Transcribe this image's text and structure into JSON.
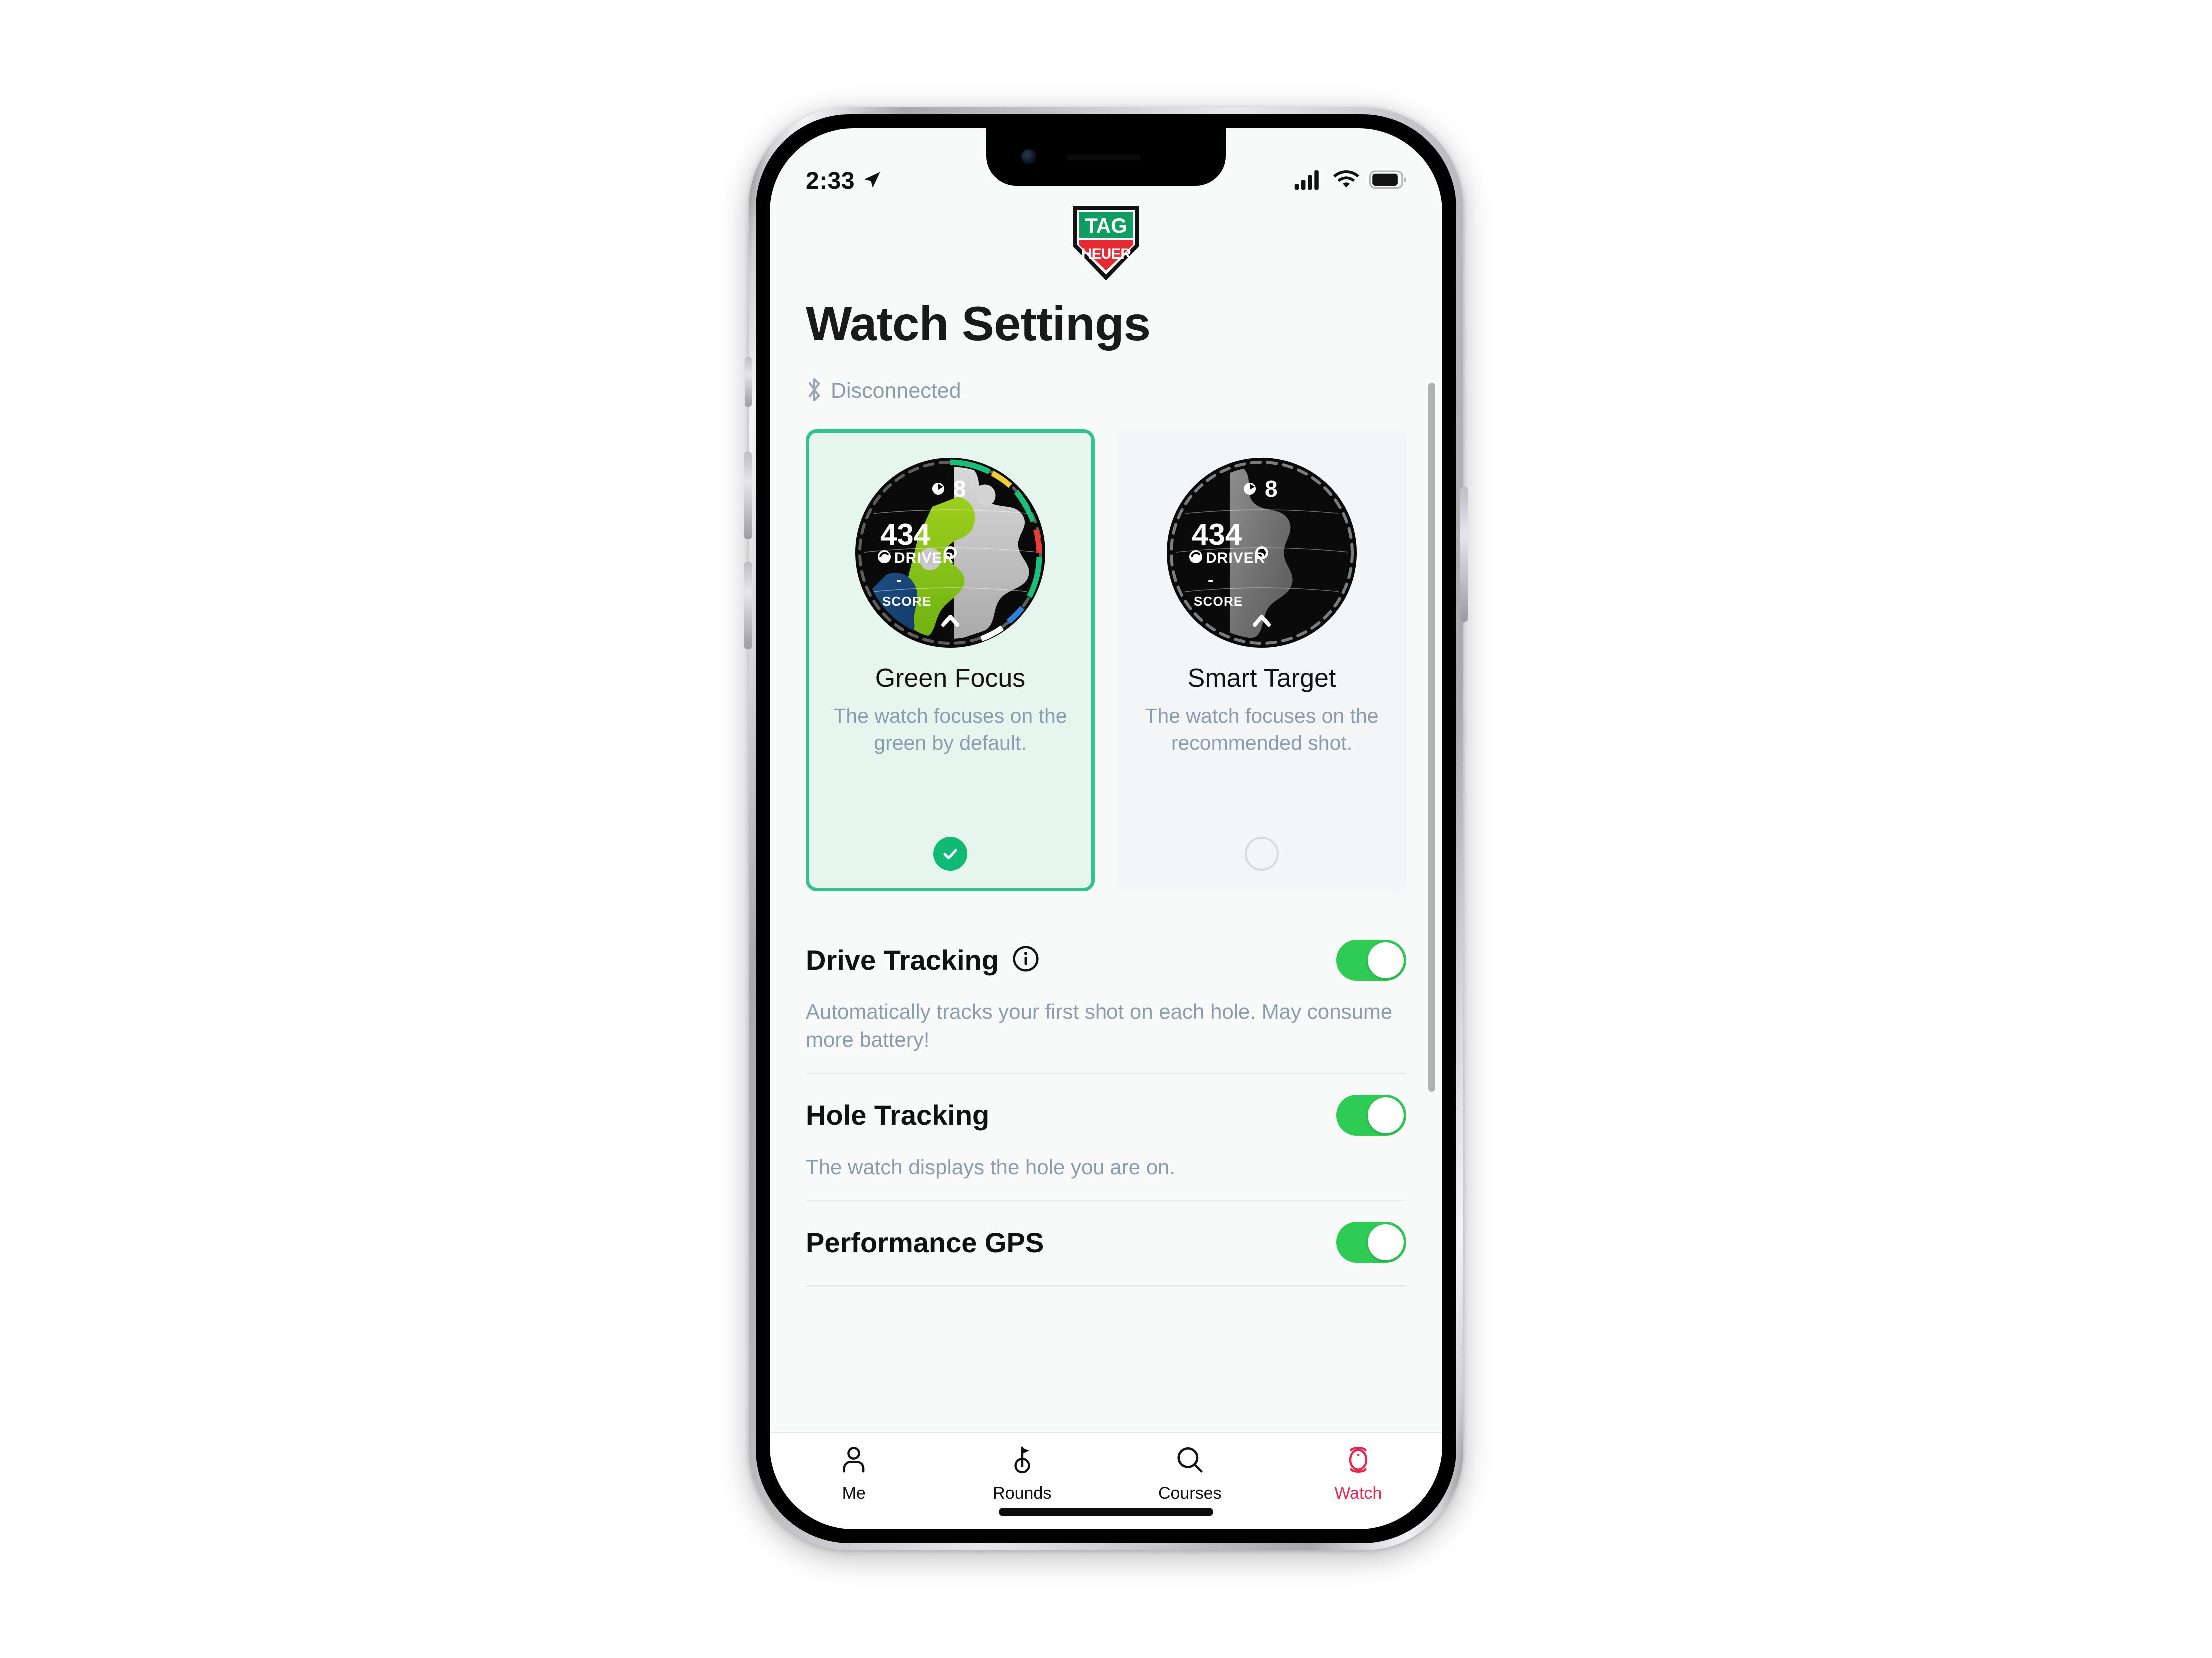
{
  "status_bar": {
    "time": "2:33",
    "location_icon": "location-arrow-icon",
    "cellular_icon": "cellular-signal-icon",
    "wifi_icon": "wifi-icon",
    "battery_icon": "battery-icon",
    "battery_level_pct": 85,
    "signal_bars": 4
  },
  "brand": {
    "logo_name": "tag-heuer-logo",
    "top_text": "TAG",
    "bottom_text": "HEUER",
    "green": "#0e9e62",
    "red": "#e52a33"
  },
  "header": {
    "title": "Watch Settings"
  },
  "connection": {
    "icon": "bluetooth-icon",
    "status": "Disconnected",
    "color": "#8b9bae"
  },
  "colors": {
    "accent_green": "#31c292",
    "toggle_green": "#2fcc55",
    "check_green": "#0fba77",
    "card_selected_bg": "#e6f6ef",
    "card_unselected_bg": "#f4f5f6",
    "muted_text": "#8b9bae",
    "tab_active": "#e8264f",
    "screen_bg": "#f8faf9"
  },
  "watch_face": {
    "hole_icon": "golf-flag-icon",
    "hole_number": "8",
    "distance": "434",
    "club_icon": "club-icon",
    "club": "DRIVER",
    "score_value": "-",
    "score_label": "SCORE",
    "chevron_icon": "chevron-up-icon"
  },
  "modes": {
    "section_name": "watch-face-mode-selector",
    "items": [
      {
        "id": "green-focus",
        "title": "Green Focus",
        "description": "The watch focuses on the green by default.",
        "selected": true,
        "preview": "color",
        "radio_icon": "check-circle-icon"
      },
      {
        "id": "smart-target",
        "title": "Smart Target",
        "description": "The watch focuses on the recommended shot.",
        "selected": false,
        "preview": "grayscale",
        "radio_icon": "radio-empty-icon"
      }
    ]
  },
  "settings": [
    {
      "id": "drive-tracking",
      "label": "Drive Tracking",
      "info_icon": "info-icon",
      "has_info": true,
      "description": "Automatically tracks your first shot on each hole. May consume more battery!",
      "toggle_on": true
    },
    {
      "id": "hole-tracking",
      "label": "Hole Tracking",
      "has_info": false,
      "description": "The watch displays the hole you are on.",
      "toggle_on": true
    },
    {
      "id": "performance-gps",
      "label": "Performance GPS",
      "has_info": false,
      "description": "",
      "toggle_on": true
    }
  ],
  "tabs": [
    {
      "id": "me",
      "label": "Me",
      "icon": "person-icon",
      "active": false
    },
    {
      "id": "rounds",
      "label": "Rounds",
      "icon": "golf-flag-icon",
      "active": false
    },
    {
      "id": "courses",
      "label": "Courses",
      "icon": "magnifier-icon",
      "active": false
    },
    {
      "id": "watch",
      "label": "Watch",
      "icon": "watch-icon",
      "active": true
    }
  ]
}
